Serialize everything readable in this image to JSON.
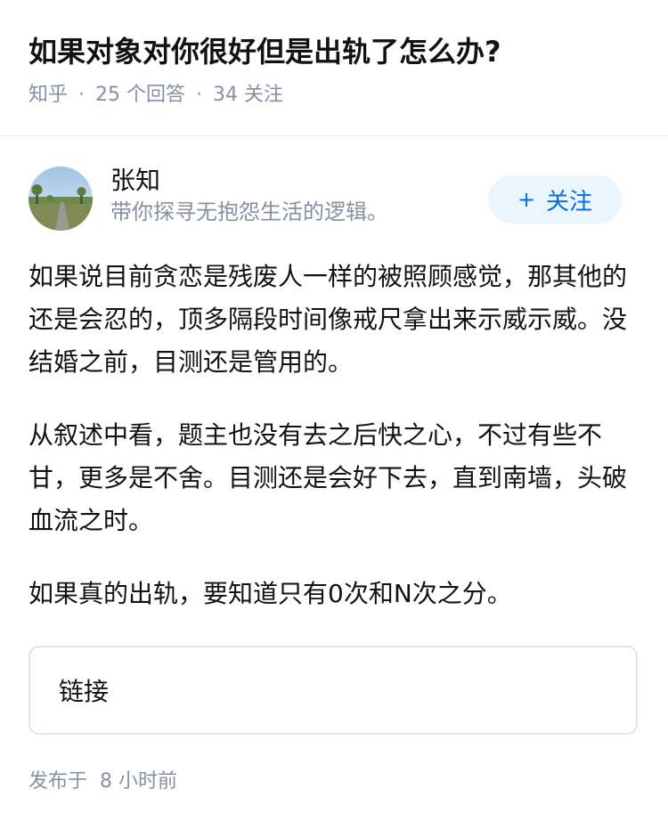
{
  "question": {
    "title": "如果对象对你很好但是出轨了怎么办?",
    "source": "知乎",
    "answer_count": "25",
    "answer_count_label": "个回答",
    "follower_count": "34",
    "follower_count_label": "关注"
  },
  "author": {
    "name": "张知",
    "bio": "带你探寻无抱怨生活的逻辑。",
    "avatar_icon": "avatar-landscape-photo",
    "follow_plus": "+",
    "follow_label": "关注"
  },
  "answer": {
    "paragraphs": [
      "如果说目前贪恋是残废人一样的被照顾感觉，那其他的还是会忍的，顶多隔段时间像戒尺拿出来示威示威。没结婚之前，目测还是管用的。",
      "从叙述中看，题主也没有去之后快之心，不过有些不甘，更多是不舍。目测还是会好下去，直到南墙，头破血流之时。",
      "如果真的出轨，要知道只有0次和N次之分。"
    ],
    "link_label": "链接",
    "published_prefix": "发布于",
    "published_time": "8 小时前"
  },
  "colors": {
    "accent": "#056de8",
    "accent_bg": "#ebf5fd",
    "meta_gray": "#8590a6"
  }
}
